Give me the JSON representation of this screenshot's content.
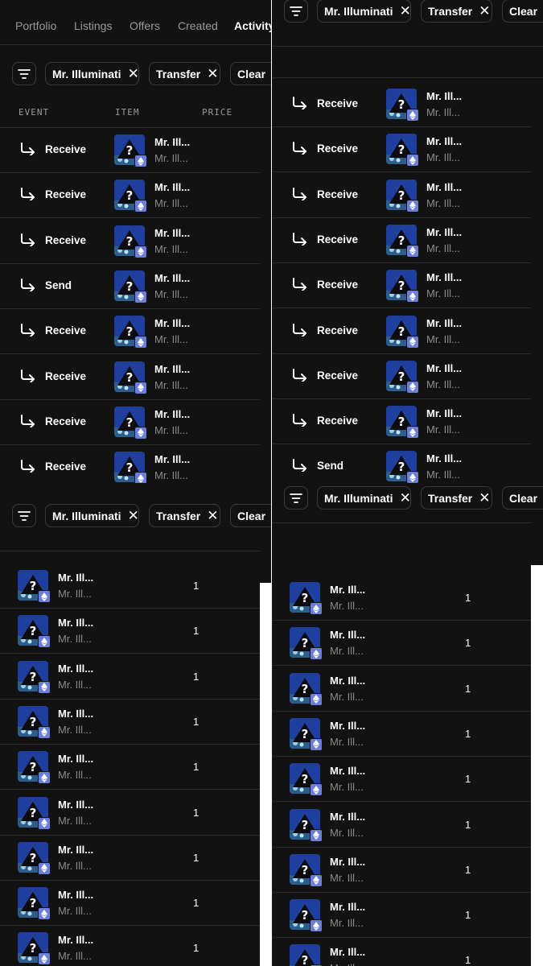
{
  "tabs": [
    "Portfolio",
    "Listings",
    "Offers",
    "Created",
    "Activity"
  ],
  "active_tab": "Activity",
  "filters": {
    "collection": "Mr. Illuminati",
    "event_type": "Transfer",
    "clear_label": "Clear",
    "remove_symbol": "✕"
  },
  "columns": {
    "event": "EVENT",
    "item": "ITEM",
    "price": "PRICE"
  },
  "item": {
    "name": "Mr. Ill...",
    "collection": "Mr. Ill...",
    "quantity": "1"
  },
  "panel1": {
    "events": [
      "Receive",
      "Receive",
      "Receive",
      "Send",
      "Receive",
      "Receive",
      "Receive",
      "Receive"
    ]
  },
  "panel2": {
    "events": [
      "Receive",
      "Receive",
      "Receive",
      "Receive",
      "Receive",
      "Receive",
      "Receive",
      "Receive",
      "Send"
    ]
  },
  "panel3": {
    "rows": 9
  },
  "panel4": {
    "rows": 9
  },
  "colors": {
    "background": "#121212",
    "divider": "#2a2a2a",
    "muted_text": "#9a9a9a",
    "eth_badge": "#6b7fd8",
    "thumb_blue": "#1e3f9c"
  },
  "icons": {
    "filter": "filter-icon",
    "event": "transfer-arrow-icon",
    "chain": "ethereum-icon",
    "remove": "close-icon"
  }
}
